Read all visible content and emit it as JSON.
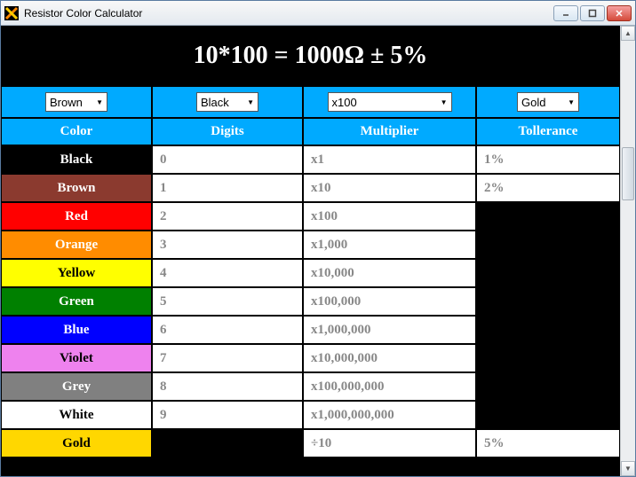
{
  "window": {
    "title": "Resistor Color Calculator"
  },
  "result": "10*100 = 1000Ω ± 5%",
  "dropdowns": {
    "band1": "Brown",
    "band2": "Black",
    "multiplier": "x100",
    "tolerance": "Gold"
  },
  "headers": {
    "color": "Color",
    "digits": "Digits",
    "multiplier": "Multiplier",
    "tolerance": "Tollerance"
  },
  "rows": [
    {
      "name": "Black",
      "bg": "#000000",
      "fg": "#ffffff",
      "digit": "0",
      "mult": "x1",
      "tol": "1%"
    },
    {
      "name": "Brown",
      "bg": "#8b3a2f",
      "fg": "#ffffff",
      "digit": "1",
      "mult": "x10",
      "tol": "2%"
    },
    {
      "name": "Red",
      "bg": "#ff0000",
      "fg": "#ffffff",
      "digit": "2",
      "mult": "x100",
      "tol": ""
    },
    {
      "name": "Orange",
      "bg": "#ff8c00",
      "fg": "#ffffff",
      "digit": "3",
      "mult": "x1,000",
      "tol": ""
    },
    {
      "name": "Yellow",
      "bg": "#ffff00",
      "fg": "#000000",
      "digit": "4",
      "mult": "x10,000",
      "tol": ""
    },
    {
      "name": "Green",
      "bg": "#008000",
      "fg": "#ffffff",
      "digit": "5",
      "mult": "x100,000",
      "tol": ""
    },
    {
      "name": "Blue",
      "bg": "#0000ff",
      "fg": "#ffffff",
      "digit": "6",
      "mult": "x1,000,000",
      "tol": ""
    },
    {
      "name": "Violet",
      "bg": "#ee82ee",
      "fg": "#000000",
      "digit": "7",
      "mult": "x10,000,000",
      "tol": ""
    },
    {
      "name": "Grey",
      "bg": "#808080",
      "fg": "#ffffff",
      "digit": "8",
      "mult": "x100,000,000",
      "tol": ""
    },
    {
      "name": "White",
      "bg": "#ffffff",
      "fg": "#000000",
      "digit": "9",
      "mult": "x1,000,000,000",
      "tol": ""
    },
    {
      "name": "Gold",
      "bg": "#ffd700",
      "fg": "#000000",
      "digit": "",
      "mult": "÷10",
      "tol": "5%"
    }
  ]
}
